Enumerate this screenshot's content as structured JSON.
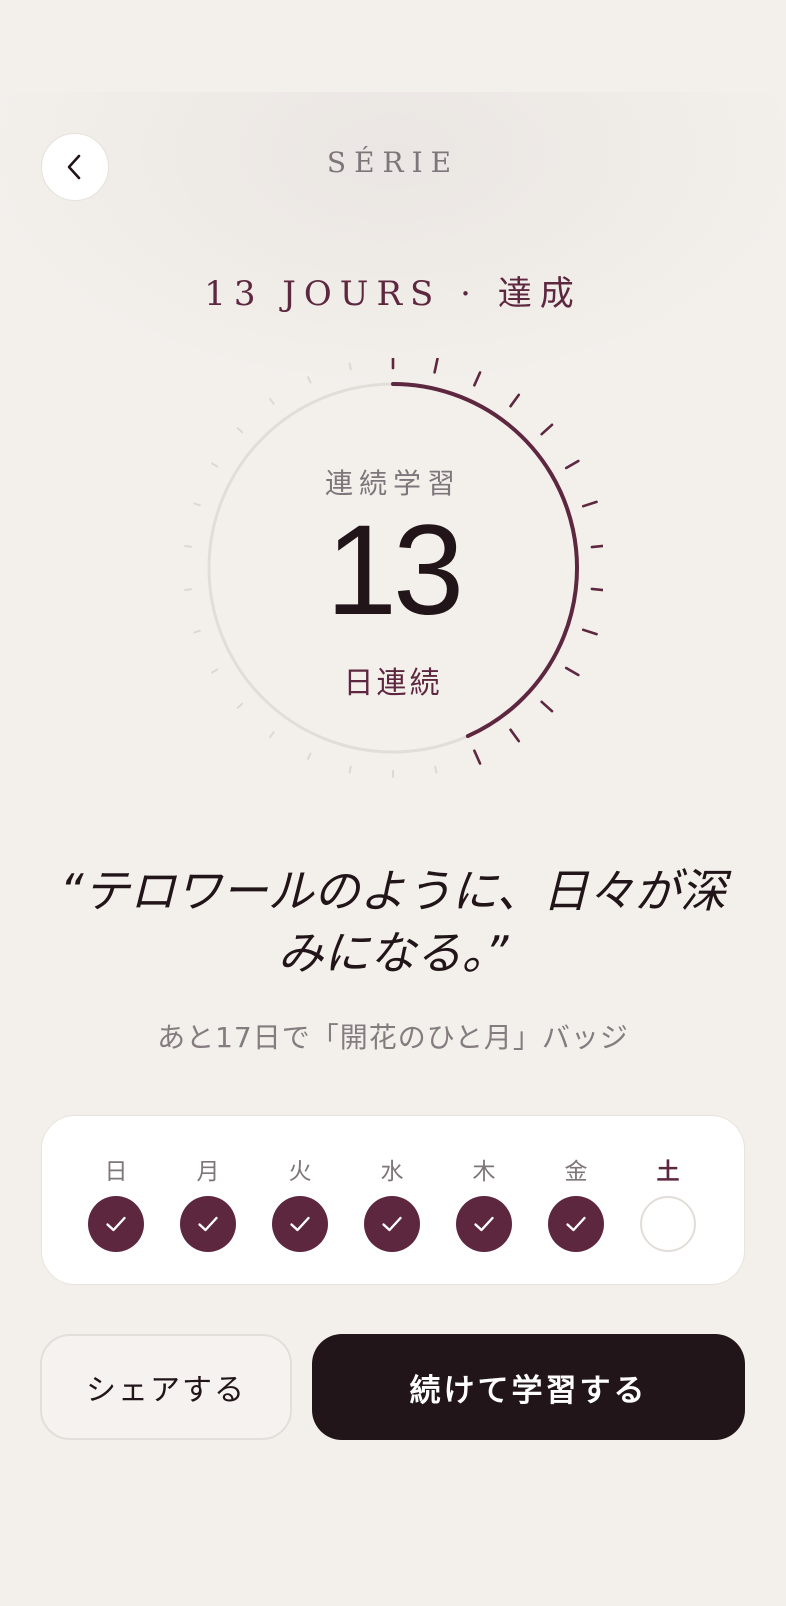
{
  "header": {
    "title": "SÉRIE",
    "back_icon": "chevron-left-icon"
  },
  "achievement": {
    "text": "13 JOURS · 達成"
  },
  "ring": {
    "label": "連続学習",
    "value": "13",
    "unit": "日連続",
    "progress_fraction": 0.4333,
    "tick_count": 30,
    "accent_color": "#5e2740",
    "track_color": "#e2ddd8"
  },
  "quote": {
    "text": "“テロワールのように、日々が深みになる。”"
  },
  "badge_hint": {
    "text": "あと17日で「開花のひと月」バッジ"
  },
  "week": {
    "days": [
      {
        "label": "日",
        "done": true
      },
      {
        "label": "月",
        "done": true
      },
      {
        "label": "火",
        "done": true
      },
      {
        "label": "水",
        "done": true
      },
      {
        "label": "木",
        "done": true
      },
      {
        "label": "金",
        "done": true
      },
      {
        "label": "土",
        "done": false,
        "today": true
      }
    ],
    "check_icon": "check-icon"
  },
  "actions": {
    "share_label": "シェアする",
    "continue_label": "続けて学習する"
  },
  "colors": {
    "background": "#f3f0ec",
    "accent": "#5e2740",
    "primary_button": "#22151a"
  }
}
